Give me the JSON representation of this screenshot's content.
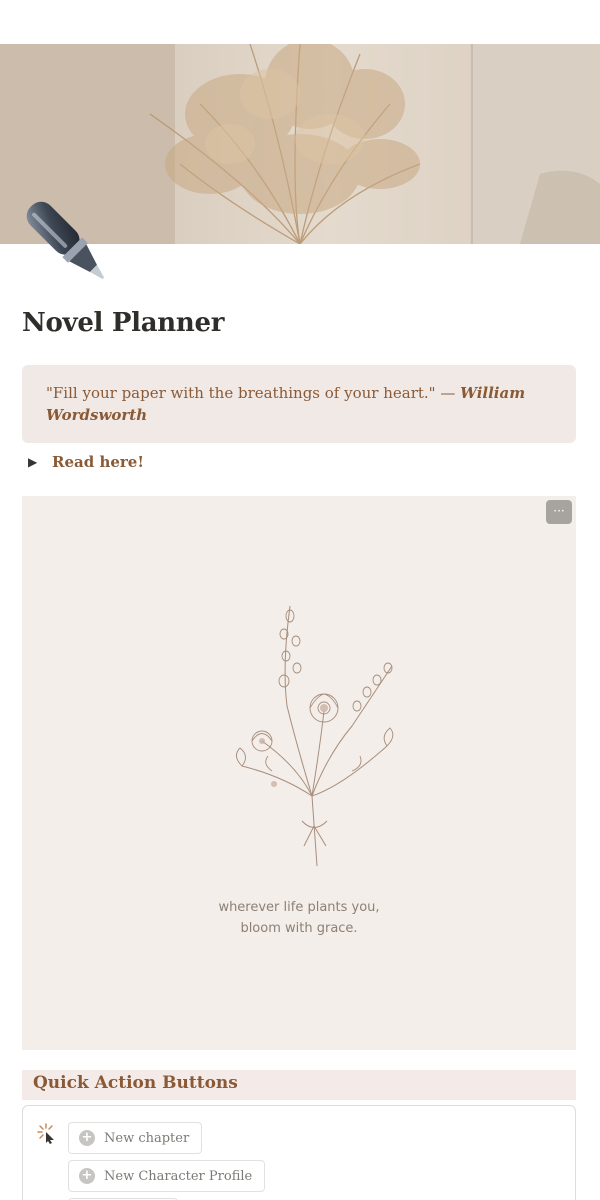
{
  "page": {
    "title": "Novel Planner",
    "cover": "pampas-grass-photo",
    "icon": "fountain-pen-icon"
  },
  "callout": {
    "quote": "\"Fill your paper with the breathings of your heart.\" — ",
    "author": "William Wordsworth"
  },
  "toggle": {
    "label": "Read here!"
  },
  "embed": {
    "quote_line1": "wherever life plants you,",
    "quote_line2": "bloom with grace.",
    "menu_label": "···"
  },
  "quick_actions": {
    "heading": "Quick Action Buttons",
    "buttons": [
      {
        "label": "New chapter"
      },
      {
        "label": "New Character Profile"
      },
      {
        "label": ""
      }
    ]
  },
  "colors": {
    "accent_brown": "#8a5a36",
    "callout_bg": "#f1e9e6",
    "embed_bg": "#f3eee9"
  }
}
